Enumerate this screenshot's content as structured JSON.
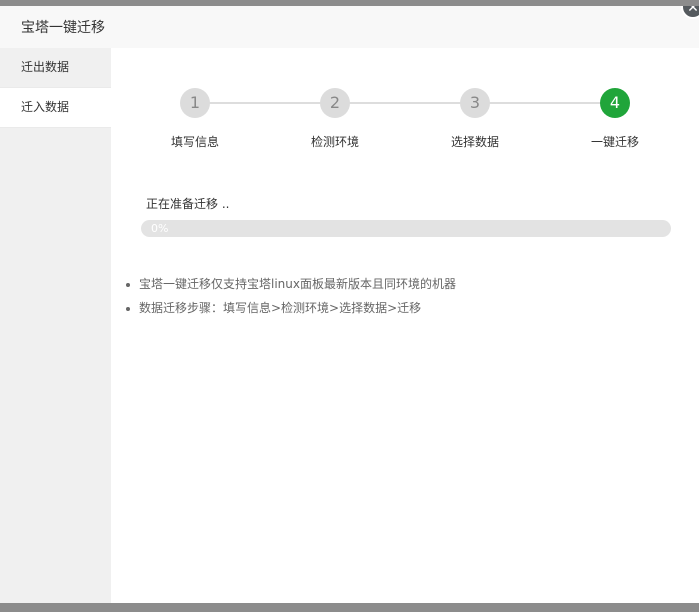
{
  "dialog": {
    "title": "宝塔一键迁移",
    "close_icon": "close-icon"
  },
  "sidebar": {
    "items": [
      {
        "label": "迁出数据",
        "active": false
      },
      {
        "label": "迁入数据",
        "active": true
      }
    ]
  },
  "steps": [
    {
      "number": "1",
      "label": "填写信息",
      "active": false
    },
    {
      "number": "2",
      "label": "检测环境",
      "active": false
    },
    {
      "number": "3",
      "label": "选择数据",
      "active": false
    },
    {
      "number": "4",
      "label": "一键迁移",
      "active": true
    }
  ],
  "migration": {
    "status": "正在准备迁移 ..",
    "progress_percent": 0,
    "progress_label": "0%"
  },
  "tips": [
    "宝塔一键迁移仅支持宝塔linux面板最新版本且同环境的机器",
    "数据迁移步骤：填写信息>检测环境>选择数据>迁移"
  ],
  "colors": {
    "accent": "#20a53a",
    "step_inactive": "#dcdcdc"
  }
}
